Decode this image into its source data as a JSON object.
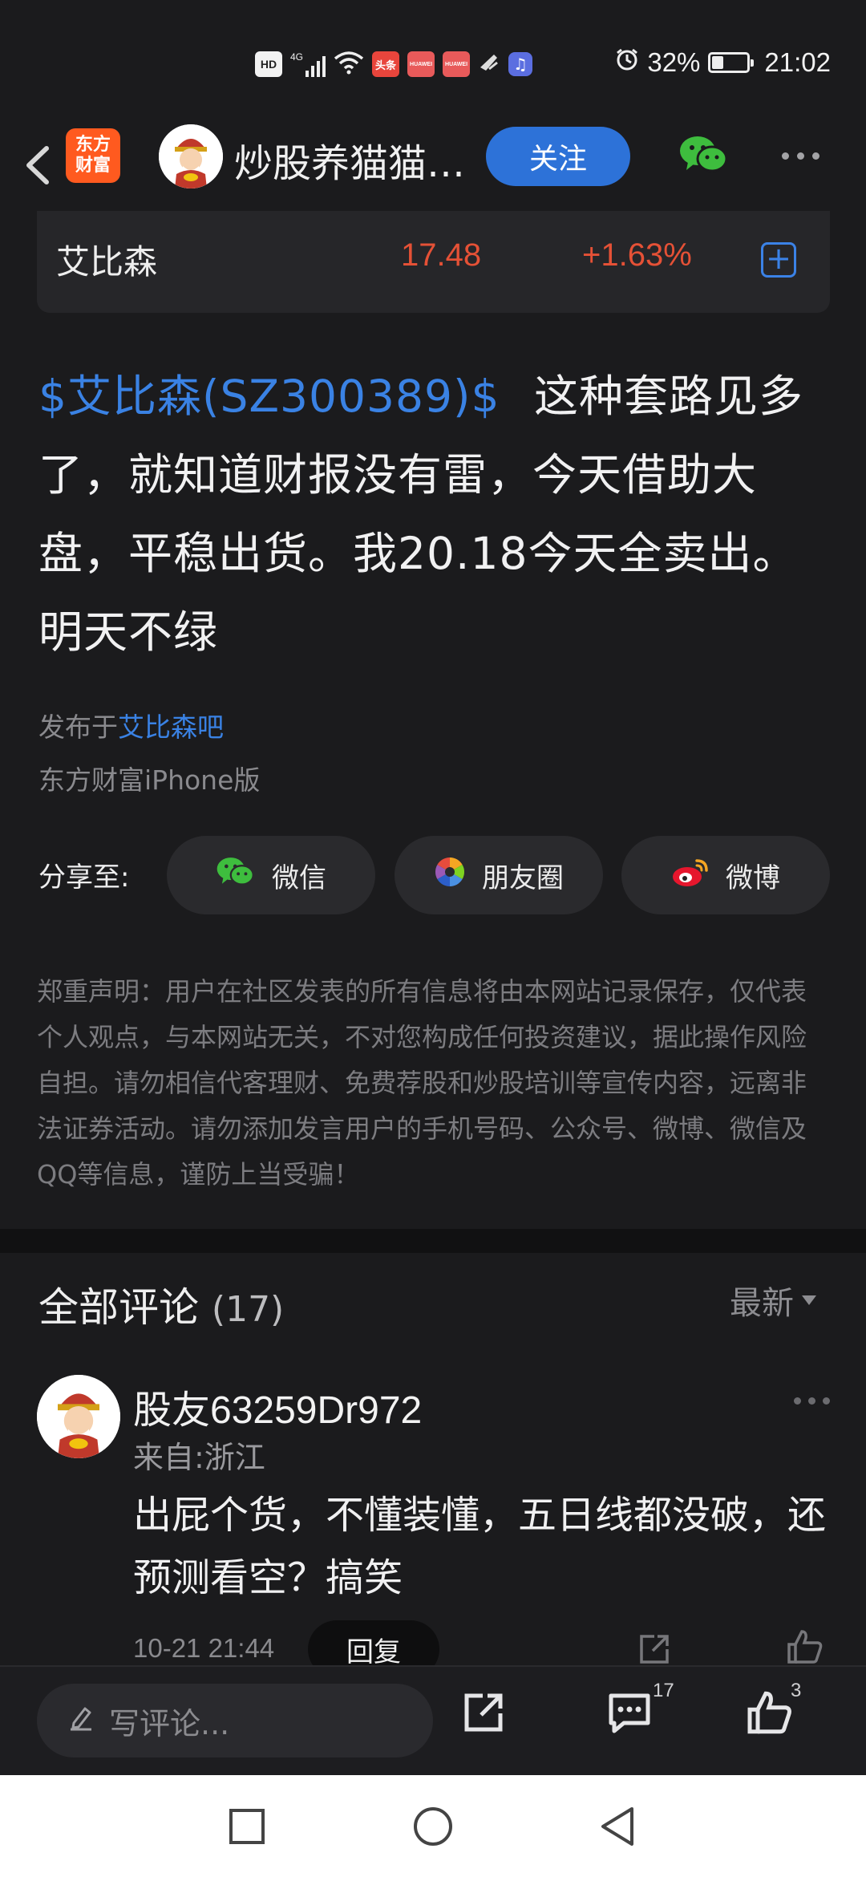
{
  "status_bar": {
    "hd": "HD",
    "signal": "4G",
    "toutiao": "头条",
    "huawei1": "HUAWEI",
    "huawei2": "HUAWEI",
    "battery_percent": "32%",
    "battery_level": 0.32,
    "time": "21:02"
  },
  "nav": {
    "logo_line1": "东方",
    "logo_line2": "财富",
    "title": "炒股养猫猫…",
    "follow_label": "关注"
  },
  "stock": {
    "name": "艾比森",
    "price": "17.48",
    "change": "+1.63%",
    "add_label": "+"
  },
  "post": {
    "stock_tag": "$艾比森(SZ300389)$",
    "body": "这种套路见多了，就知道财报没有雷，今天借助大盘，平稳出货。我20.18今天全卖出。明天不绿",
    "published_prefix": "发布于",
    "bar_name": "艾比森吧",
    "client": "东方财富iPhone版"
  },
  "share": {
    "label": "分享至:",
    "wechat": "微信",
    "moments": "朋友圈",
    "weibo": "微博"
  },
  "disclaimer": "郑重声明：用户在社区发表的所有信息将由本网站记录保存，仅代表个人观点，与本网站无关，不对您构成任何投资建议，据此操作风险自担。请勿相信代客理财、免费荐股和炒股培训等宣传内容，远离非法证券活动。请勿添加发言用户的手机号码、公众号、微博、微信及QQ等信息，谨防上当受骗！",
  "comments": {
    "title": "全部评论",
    "count": "(17)",
    "sort": "最新",
    "items": [
      {
        "user": "股友63259Dr972",
        "location": "来自:浙江",
        "text": "出屁个货，不懂装懂，五日线都没破，还预测看空？搞笑",
        "time": "10-21 21:44",
        "reply_label": "回复"
      }
    ]
  },
  "action_bar": {
    "input_placeholder": "写评论...",
    "comment_count": "17",
    "like_count": "3"
  },
  "colors": {
    "accent_blue": "#2d72d8",
    "price_red": "#e55136",
    "background": "#1b1b1d"
  }
}
